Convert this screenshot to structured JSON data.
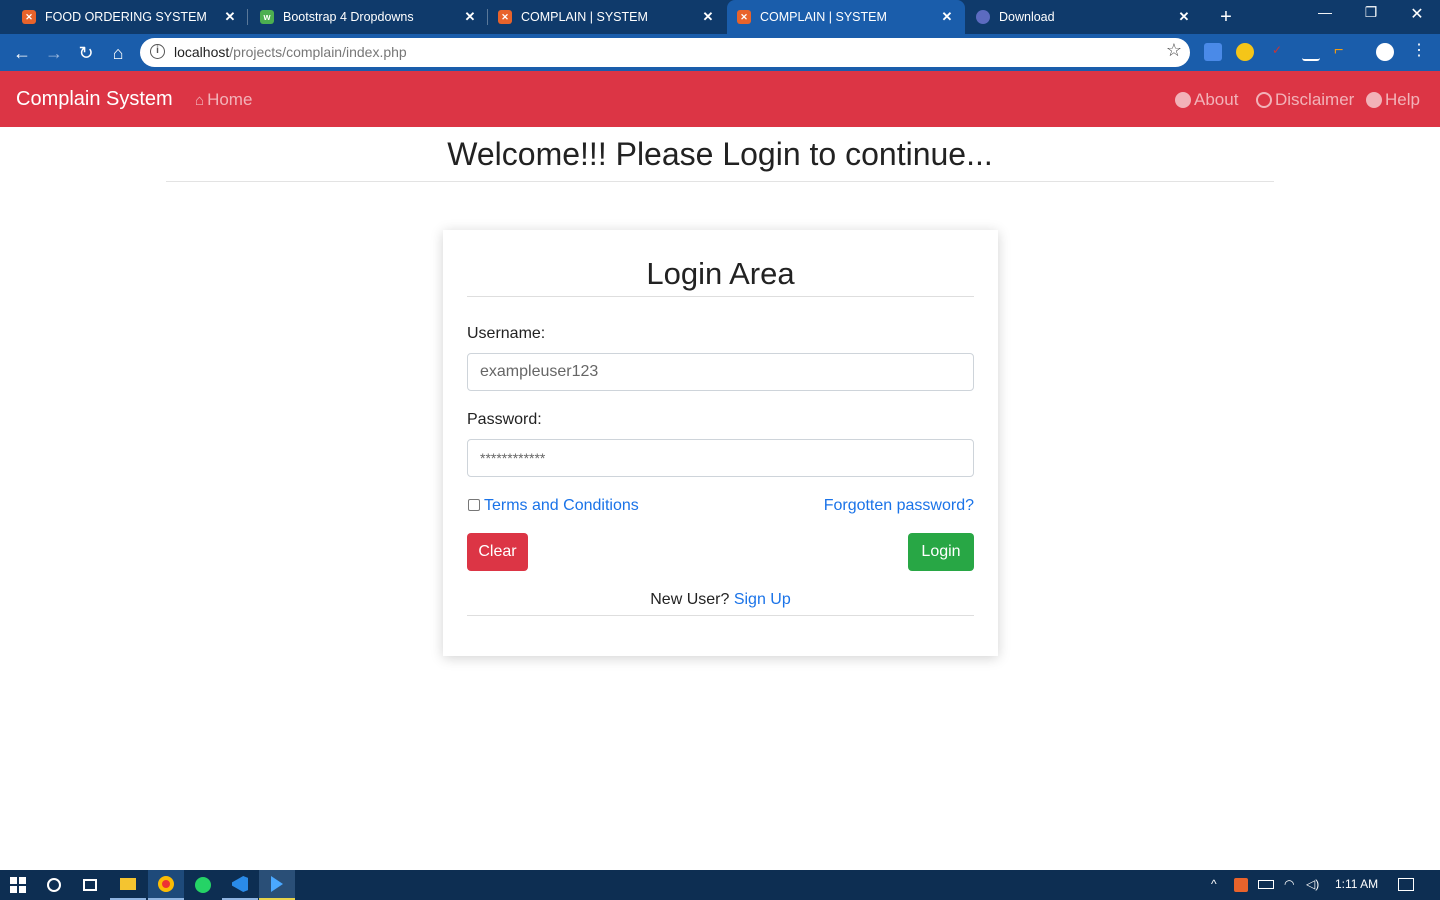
{
  "browser": {
    "tabs": [
      {
        "title": "FOOD ORDERING SYSTEM",
        "active": false,
        "favicon": "xampp-icon"
      },
      {
        "title": "Bootstrap 4 Dropdowns",
        "active": false,
        "favicon": "w3-icon"
      },
      {
        "title": "COMPLAIN | SYSTEM",
        "active": false,
        "favicon": "xampp-icon"
      },
      {
        "title": "COMPLAIN | SYSTEM",
        "active": true,
        "favicon": "xampp-icon"
      },
      {
        "title": "Download",
        "active": false,
        "favicon": "globe-icon"
      }
    ],
    "url_host": "localhost",
    "url_path": "/projects/complain/index.php"
  },
  "site": {
    "brand": "Complain System",
    "nav_left": [
      {
        "label": "Home",
        "icon": "home-icon"
      }
    ],
    "nav_right": [
      {
        "label": "About",
        "icon": "user-circle-icon"
      },
      {
        "label": "Disclaimer",
        "icon": "copyright-icon"
      },
      {
        "label": "Help",
        "icon": "info-icon"
      }
    ],
    "accent": "#dc3545"
  },
  "page": {
    "welcome": "Welcome!!! Please Login to continue...",
    "card_title": "Login Area",
    "username_label": "Username:",
    "username_value": "exampleuser123",
    "password_label": "Password:",
    "password_value": "************",
    "terms_label": "Terms and Conditions",
    "forgot_label": "Forgotten password?",
    "clear_label": "Clear",
    "login_label": "Login",
    "new_user_text": "New User?",
    "signup_label": "Sign Up"
  },
  "taskbar": {
    "time": "1:11 AM"
  }
}
